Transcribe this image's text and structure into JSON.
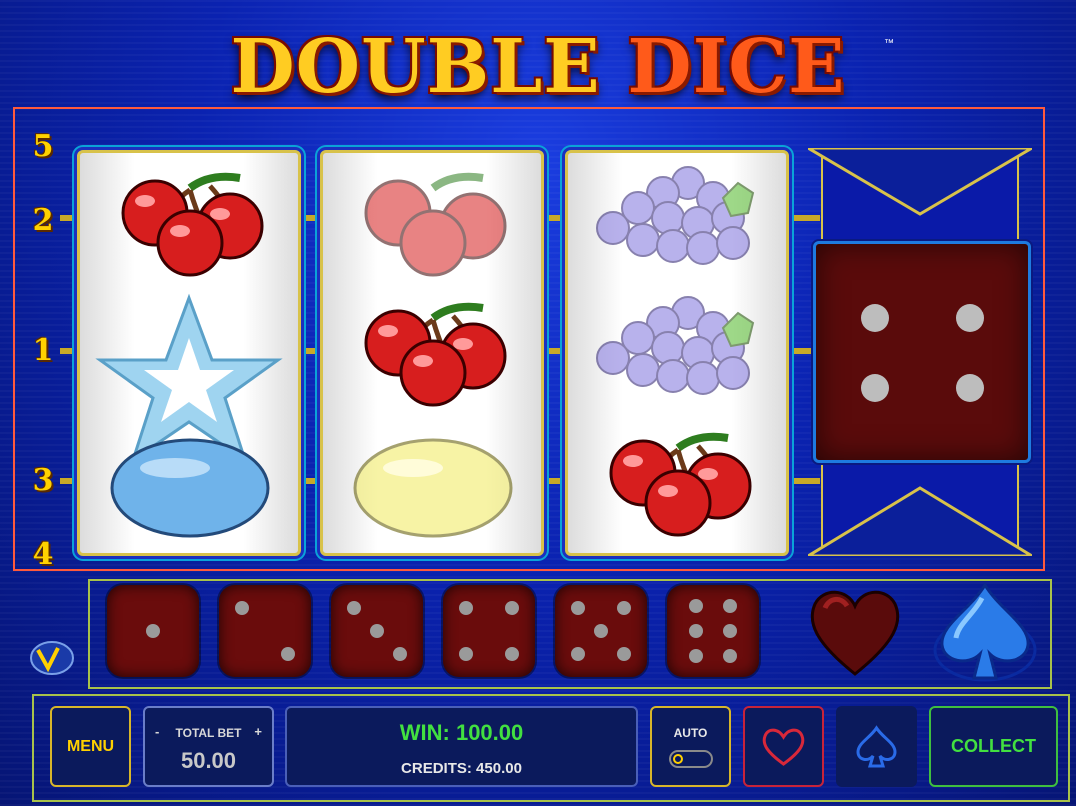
{
  "title": {
    "word1": "DOUBLE",
    "word2": "DICE",
    "trademark": "™"
  },
  "paylines": {
    "left_numbers": [
      "5",
      "2",
      "1",
      "3",
      "4"
    ]
  },
  "reels": [
    {
      "symbols": [
        "cherry-icon",
        "star-icon",
        "plum-icon"
      ]
    },
    {
      "symbols": [
        "cherry-icon",
        "cherry-icon",
        "lemon-icon"
      ]
    },
    {
      "symbols": [
        "grapes-icon",
        "grapes-icon",
        "cherry-icon"
      ]
    }
  ],
  "big_die": {
    "value": 4
  },
  "bonus_dice": {
    "values": [
      1,
      2,
      3,
      4,
      5,
      6
    ]
  },
  "gamble": {
    "heart": "heart-icon",
    "spade": "spade-icon"
  },
  "controls": {
    "menu_label": "MENU",
    "total_bet_label": "TOTAL BET",
    "bet_minus": "-",
    "bet_plus": "+",
    "total_bet_value": "50.00",
    "win_text": "WIN: 100.00",
    "credits_text": "CREDITS: 450.00",
    "auto_label": "AUTO",
    "collect_label": "COLLECT"
  },
  "colors": {
    "win": "#42e040",
    "accent": "#ffd000",
    "collect": "#42e040"
  }
}
